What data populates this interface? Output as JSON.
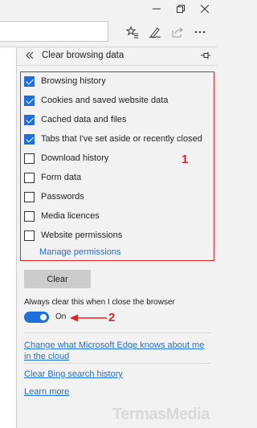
{
  "checkbox_items": [
    {
      "label": "Browsing history",
      "checked": true
    },
    {
      "label": "Cookies and saved website data",
      "checked": true
    },
    {
      "label": "Cached data and files",
      "checked": true
    },
    {
      "label": "Tabs that I've set aside or recently closed",
      "checked": true
    },
    {
      "label": "Download history",
      "checked": false
    },
    {
      "label": "Form data",
      "checked": false
    },
    {
      "label": "Passwords",
      "checked": false
    },
    {
      "label": "Media licences",
      "checked": false
    },
    {
      "label": "Website permissions",
      "checked": false
    }
  ],
  "panel": {
    "title": "Clear browsing data",
    "manage_link": "Manage permissions",
    "clear_button": "Clear",
    "always_clear_label": "Always clear this when I close the browser",
    "toggle_state": "On",
    "toggle_on": true,
    "links": {
      "edge": "Change what Microsoft Edge knows about me in the cloud",
      "bing": "Clear Bing search history",
      "more": "Learn more"
    }
  },
  "annotations": {
    "box_number": "1",
    "arrow_number": "2",
    "color": "#e02424"
  },
  "watermark": "TermasMedia",
  "icons": {
    "window": [
      "minimize-icon",
      "restore-icon",
      "close-icon"
    ],
    "toolbar": [
      "favorites-star-icon",
      "web-note-pen-icon",
      "share-icon",
      "more-ellipsis-icon"
    ],
    "panel": [
      "back-double-chevron-icon",
      "pin-icon"
    ]
  },
  "colors": {
    "accent": "#1e6fd9",
    "panel_bg": "#f2f2f2",
    "button_bg": "#cccccc"
  }
}
